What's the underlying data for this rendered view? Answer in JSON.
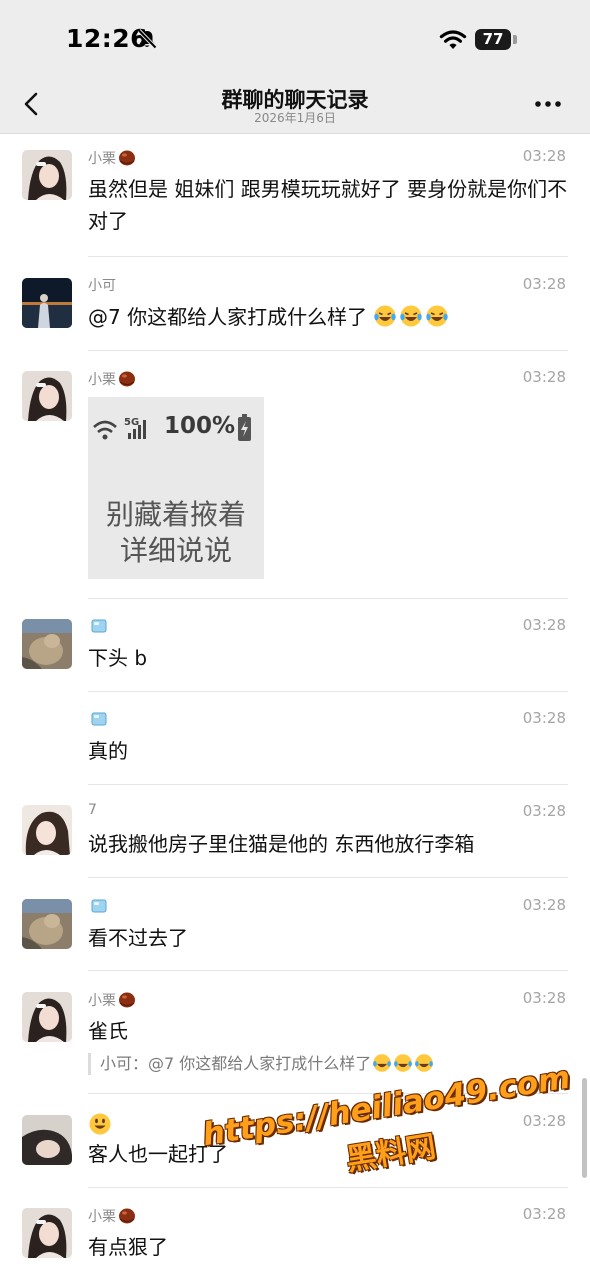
{
  "status_bar": {
    "time": "12:26",
    "battery": "77"
  },
  "nav": {
    "title": "群聊的聊天记录",
    "subtitle": "2026年1月6日"
  },
  "messages": [
    {
      "name": "小栗",
      "time": "03:28",
      "text": "虽然但是 姐妹们 跟男模玩玩就好了 要身份就是你们不对了"
    },
    {
      "name": "小可",
      "time": "03:28",
      "text": "@7 你这都给人家打成什么样了"
    },
    {
      "name": "小栗",
      "time": "03:28",
      "sticker": {
        "percent": "100%",
        "line1": "别藏着掖着",
        "line2": "详细说说"
      }
    },
    {
      "name": "",
      "time": "03:28",
      "text": "下头 b"
    },
    {
      "name": "",
      "time": "03:28",
      "text": "真的"
    },
    {
      "name": "7",
      "time": "03:28",
      "text": "说我搬他房子里住猫是他的 东西他放行李箱"
    },
    {
      "name": "",
      "time": "03:28",
      "text": "看不过去了"
    },
    {
      "name": "小栗",
      "time": "03:28",
      "text": "雀氏",
      "quote": "小可：@7 你这都给人家打成什么样了"
    },
    {
      "name": "",
      "time": "03:28",
      "text": "客人也一起打了"
    },
    {
      "name": "小栗",
      "time": "03:28",
      "text": "有点狠了"
    }
  ],
  "watermark": {
    "url": "https://heiliao49.com",
    "name": "黑料网"
  },
  "colors": {
    "header_bg": "#ededed",
    "name_gray": "#8a8a8a",
    "watermark_orange": "#ff9f1a"
  },
  "icons": [
    "bell-slash-icon",
    "wifi-icon",
    "back-chevron-icon",
    "more-dots-icon",
    "chestnut-emoji-icon",
    "ice-cube-emoji-icon",
    "laughing-crying-emoji-icon",
    "smiley-emoji-icon"
  ]
}
